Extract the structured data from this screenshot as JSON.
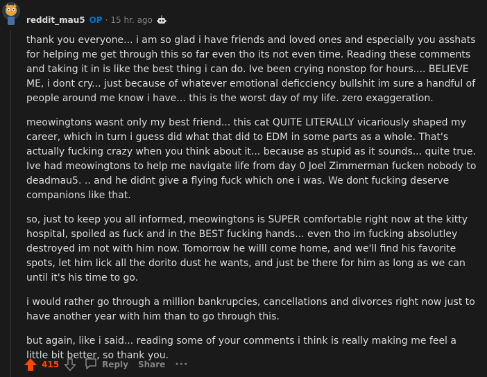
{
  "comment": {
    "author": "reddit_mau5",
    "op_badge": "OP",
    "separator": "·",
    "timestamp": "15 hr. ago",
    "paragraphs": [
      "thank you everyone... i am so glad i have friends and loved ones and especially you asshats for helping me get through this so far even tho its not even time. Reading these comments and taking it in is like the best thing i can do. Ive been crying nonstop for hours.... BELIEVE ME, i dont cry... just because of whatever emotional deficciency bullshit im sure a handful of people around me know i have... this is the worst day of my life. zero exaggeration.",
      "meowingtons wasnt only my best friend... this cat QUITE LITERALLY vicariously shaped my career, which in turn i guess did what that did to EDM in some parts as a whole. That's actually fucking crazy when you think about it... because as stupid as it sounds... quite true. Ive had meowingtons to help me navigate life from day 0 Joel Zimmerman fucken nobody to deadmau5. .. and he didnt give a flying fuck which one i was. We dont fucking deserve companions like that.",
      "so, just to keep you all informed, meowingtons is SUPER comfortable right now at the kitty hospital, spoiled as fuck and in the BEST fucking hands... even tho im fucking absolutley destroyed im not with him now. Tomorrow he willl come home, and we'll find his favorite spots, let him lick all the dorito dust he wants, and just be there for him as long as we can until it's his time to go.",
      "i would rather go through a million bankrupcies, cancellations and divorces right now just to have another year with him than to go through this.",
      "but again, like i said... reading some of your comments i think is really making me feel a little bit better, so thank you."
    ],
    "actions": {
      "score": "415",
      "reply_label": "Reply",
      "share_label": "Share",
      "more_label": "···"
    }
  },
  "colors": {
    "background": "#1a1a1b",
    "text": "#d7dadc",
    "muted": "#818384",
    "op_blue": "#0079d3",
    "upvote_orange": "#ff4500"
  },
  "icons": {
    "avatar": "avatar",
    "award": "robot-award-icon",
    "upvote": "upvote-arrow-icon",
    "downvote": "downvote-arrow-icon",
    "reply": "speech-bubble-icon",
    "more": "ellipsis-icon"
  }
}
